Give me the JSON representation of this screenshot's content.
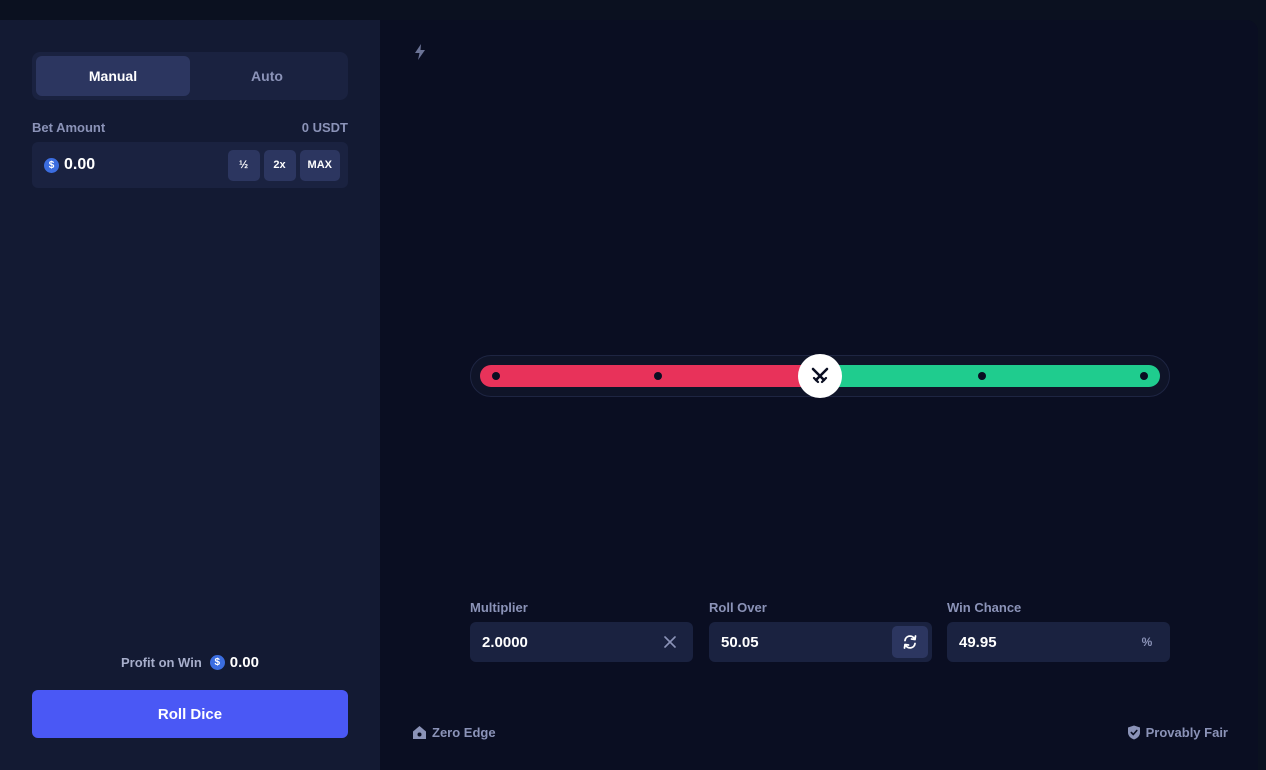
{
  "sidebar": {
    "tabs": [
      {
        "label": "Manual",
        "active": true
      },
      {
        "label": "Auto",
        "active": false
      }
    ],
    "bet_amount": {
      "label": "Bet Amount",
      "balance": "0 USDT",
      "currency_icon": "dollar-coin-icon",
      "value": "0.00",
      "buttons": {
        "half": "½",
        "double": "2x",
        "max": "MAX"
      }
    },
    "profit_on_win": {
      "label": "Profit on Win",
      "value": "0.00"
    },
    "roll_button": "Roll Dice"
  },
  "game": {
    "top_icon": "lightning-bolt-icon",
    "slider": {
      "value": 50.05,
      "lose_color": "#e8325a",
      "win_color": "#1fcc8e",
      "handle_icon": "crossed-swords-icon"
    },
    "fields": {
      "multiplier": {
        "label": "Multiplier",
        "value": "2.0000",
        "suffix_icon": "clear-x-icon"
      },
      "roll_over": {
        "label": "Roll Over",
        "value": "50.05",
        "button_icon": "swap-refresh-icon"
      },
      "win_chance": {
        "label": "Win Chance",
        "value": "49.95",
        "suffix": "%"
      }
    },
    "footer": {
      "zero_edge": "Zero Edge",
      "provably_fair": "Provably Fair"
    }
  },
  "colors": {
    "accent": "#4a58f5",
    "background": "#0a0e22",
    "sidebar": "#131a33"
  }
}
